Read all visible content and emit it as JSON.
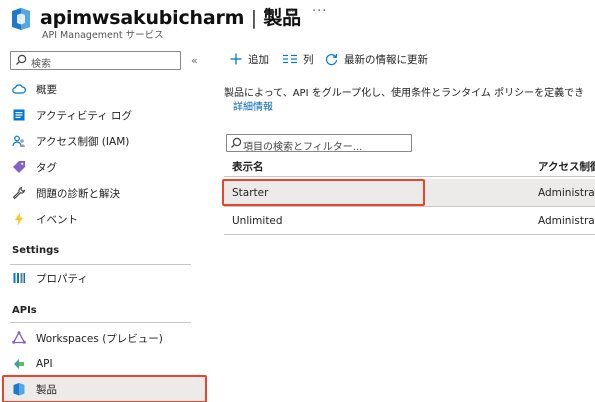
{
  "header": {
    "title": "apimwsakubicharm",
    "separator": "|",
    "page": "製品",
    "subtitle": "API Management サービス",
    "star": "☆",
    "more": "···"
  },
  "sidebar": {
    "search_placeholder": "検索",
    "collapse": "«",
    "items": [
      {
        "label": "概要",
        "icon": "cloud-icon"
      },
      {
        "label": "アクティビティ ログ",
        "icon": "activity-log-icon"
      },
      {
        "label": "アクセス制御 (IAM)",
        "icon": "people-icon"
      },
      {
        "label": "タグ",
        "icon": "tag-icon"
      },
      {
        "label": "問題の診断と解決",
        "icon": "wrench-icon"
      },
      {
        "label": "イベント",
        "icon": "lightning-icon"
      }
    ],
    "settings_label": "Settings",
    "settings_items": [
      {
        "label": "プロパティ",
        "icon": "properties-icon"
      }
    ],
    "apis_label": "APIs",
    "apis_items": [
      {
        "label": "Workspaces (プレビュー)",
        "icon": "workspaces-icon"
      },
      {
        "label": "API",
        "icon": "api-icon"
      },
      {
        "label": "製品",
        "icon": "products-icon"
      }
    ]
  },
  "toolbar": {
    "add": "追加",
    "columns": "列",
    "refresh": "最新の情報に更新"
  },
  "main": {
    "description": "製品によって、API をグループ化し、使用条件とランタイム ポリシーを定義でき",
    "learn_more": "詳細情報",
    "filter_placeholder": "項目の検索とフィルター...",
    "columns": [
      "表示名",
      "アクセス制御"
    ],
    "rows": [
      {
        "name": "Starter",
        "access": "Administrato"
      },
      {
        "name": "Unlimited",
        "access": "Administrato"
      }
    ]
  },
  "colors": {
    "accent": "#0078d4",
    "highlight": "#e8452c",
    "selected_bg": "#edebe9"
  }
}
